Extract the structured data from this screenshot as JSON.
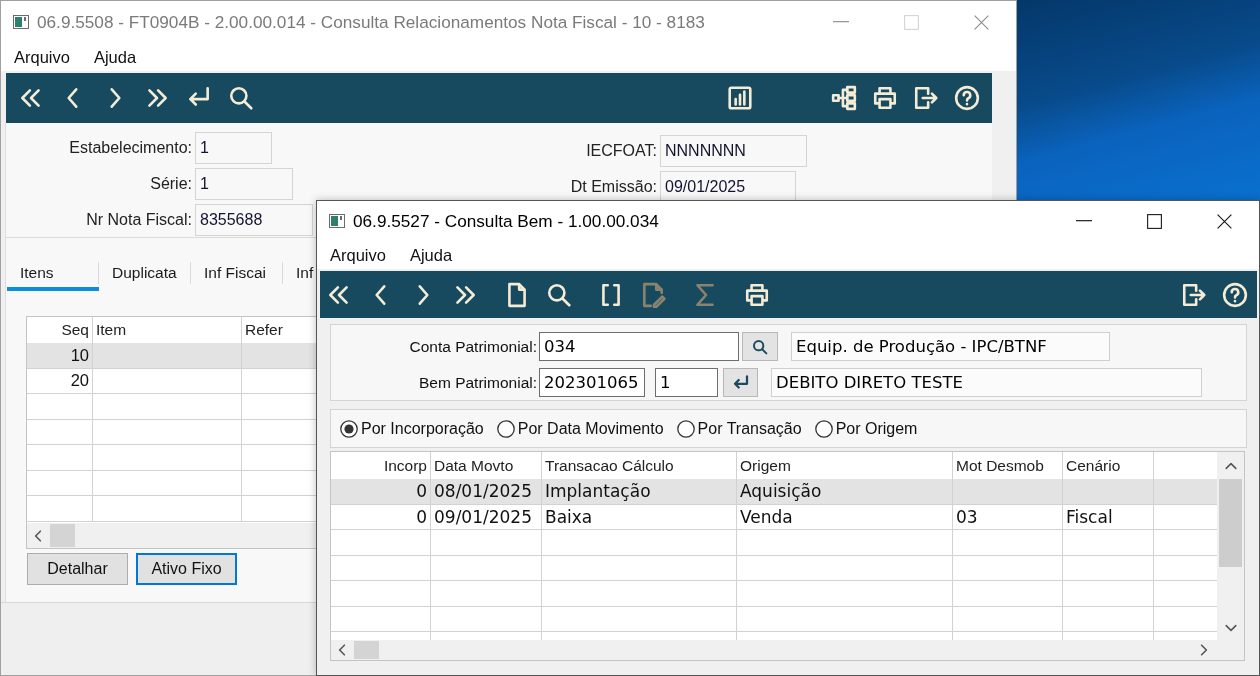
{
  "back_window": {
    "title": "06.9.5508 - FT0904B - 2.00.00.014 - Consulta Relacionamentos Nota Fiscal - 10 - 8183",
    "active": false,
    "controls": [
      {
        "kind": "minimize",
        "disabled": false
      },
      {
        "kind": "maximize",
        "disabled": true
      },
      {
        "kind": "close",
        "disabled": false
      }
    ],
    "menu": [
      "Arquivo",
      "Ajuda"
    ],
    "toolbar": {
      "left": [
        [
          {
            "kind": "first",
            "disabled": false
          },
          {
            "kind": "previous",
            "disabled": false
          },
          {
            "kind": "next",
            "disabled": false
          },
          {
            "kind": "last",
            "disabled": false
          },
          {
            "kind": "return",
            "disabled": false
          },
          {
            "kind": "search",
            "disabled": false
          }
        ]
      ],
      "center": [
        [
          {
            "kind": "chart",
            "disabled": false
          }
        ]
      ],
      "right": [
        [
          {
            "kind": "tree",
            "disabled": false
          },
          {
            "kind": "print",
            "disabled": false
          },
          {
            "kind": "exit",
            "disabled": false
          },
          {
            "kind": "help",
            "disabled": false
          }
        ]
      ]
    },
    "fields_left": [
      {
        "label": "Estabelecimento:",
        "value": "1"
      },
      {
        "label": "Série:",
        "value": "1"
      },
      {
        "label": "Nr Nota Fiscal:",
        "value": "8355688"
      }
    ],
    "fields_right": [
      {
        "label": "IECFOAT:",
        "value": "NNNNNNN"
      },
      {
        "label": "Dt Emissão:",
        "value": "09/01/2025"
      }
    ],
    "tabs": [
      {
        "label": "Itens",
        "selected": true
      },
      {
        "label": "Duplicata",
        "selected": false
      },
      {
        "label": "Inf Fiscai",
        "selected": false
      },
      {
        "label": "Inf",
        "selected": false
      }
    ],
    "table": {
      "columns": [
        "Seq",
        "Item",
        "Refer"
      ],
      "rows": [
        {
          "cells": [
            "10"
          ],
          "selected": true
        },
        {
          "cells": [
            "20"
          ],
          "selected": false
        }
      ]
    },
    "buttons": [
      {
        "label": "Detalhar",
        "focused": false
      },
      {
        "label": "Ativo Fixo",
        "focused": true
      }
    ]
  },
  "front_window": {
    "title": "06.9.5527 - Consulta Bem - 1.00.00.034",
    "active": true,
    "controls": [
      {
        "kind": "minimize",
        "disabled": false
      },
      {
        "kind": "maximize",
        "disabled": false
      },
      {
        "kind": "close",
        "disabled": false
      }
    ],
    "menu": [
      "Arquivo",
      "Ajuda"
    ],
    "toolbar": {
      "left": [
        [
          {
            "kind": "first",
            "disabled": false
          },
          {
            "kind": "previous",
            "disabled": false
          },
          {
            "kind": "next",
            "disabled": false
          },
          {
            "kind": "last",
            "disabled": false
          }
        ],
        [
          {
            "kind": "new",
            "disabled": false
          },
          {
            "kind": "search",
            "disabled": false
          }
        ],
        [
          {
            "kind": "brackets",
            "disabled": false
          },
          {
            "kind": "edit",
            "disabled": true
          }
        ],
        [
          {
            "kind": "sigma",
            "disabled": true
          }
        ],
        [
          {
            "kind": "print",
            "disabled": false
          }
        ]
      ],
      "right": [
        [
          {
            "kind": "exit",
            "disabled": false
          },
          {
            "kind": "help",
            "disabled": false
          }
        ]
      ]
    },
    "conta_patrimonial": {
      "label": "Conta Patrimonial:",
      "code": "034",
      "description": "Equip. de Produção - IPC/BTNF"
    },
    "bem_patrimonial": {
      "label": "Bem Patrimonial:",
      "code": "202301065",
      "sequence": "1",
      "description": "DEBITO DIRETO TESTE"
    },
    "sort_options": [
      {
        "label": "Por Incorporação",
        "selected": true
      },
      {
        "label": "Por Data Movimento",
        "selected": false
      },
      {
        "label": "Por Transação",
        "selected": false
      },
      {
        "label": "Por Origem",
        "selected": false
      }
    ],
    "table": {
      "columns": [
        "Incorp",
        "Data Movto",
        "Transacao Cálculo",
        "Origem",
        "Mot Desmob",
        "Cenário"
      ],
      "rows": [
        {
          "cells": [
            "0",
            "08/01/2025",
            "Implantação",
            "Aquisição"
          ],
          "selected": true
        },
        {
          "cells": [
            "0",
            "09/01/2025",
            "Baixa",
            "Venda",
            "03",
            "Fiscal"
          ],
          "selected": false
        }
      ]
    }
  }
}
